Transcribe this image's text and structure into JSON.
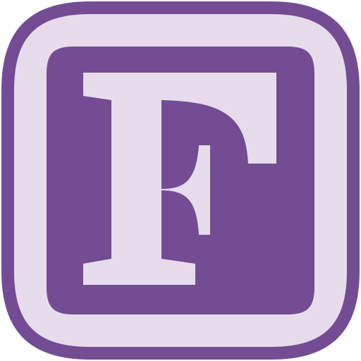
{
  "icon": {
    "name": "letter-f-app-icon",
    "letter": "F",
    "colors": {
      "outer_purple": "#734c93",
      "light_lavender": "#e6dcec",
      "inner_purple": "#734c93",
      "letter_fill": "#e6dcec"
    }
  }
}
